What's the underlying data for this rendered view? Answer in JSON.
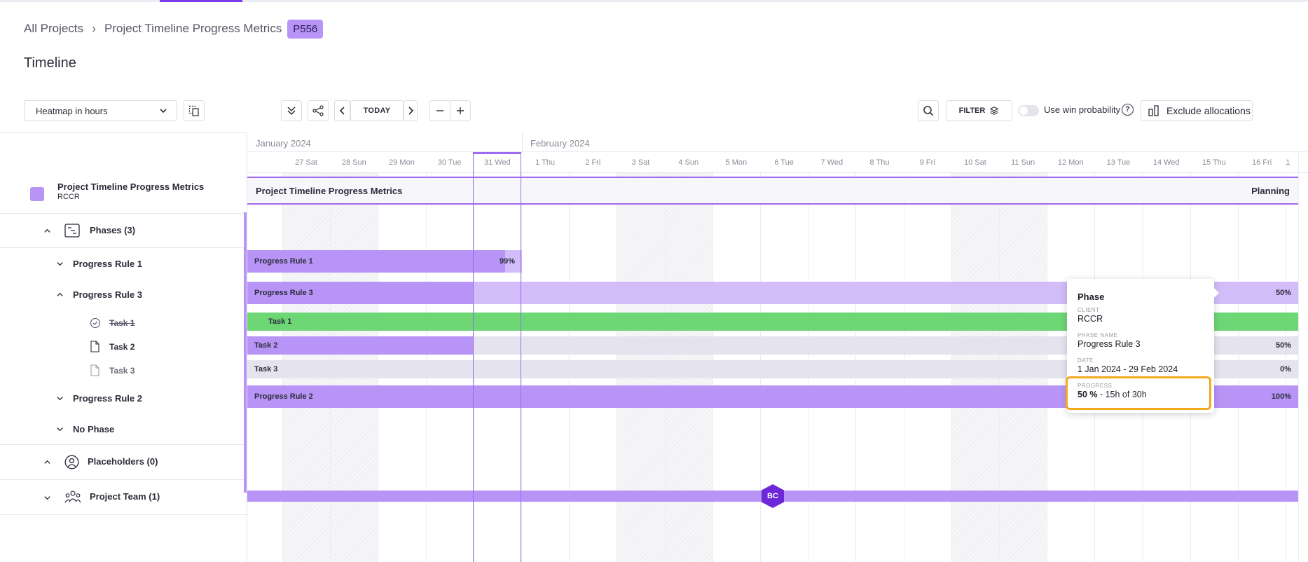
{
  "breadcrumb": {
    "root": "All Projects",
    "current": "Project Timeline Progress Metrics",
    "badge": "P556"
  },
  "page_title": "Timeline",
  "toolbar": {
    "view_select": "Heatmap in hours",
    "today_label": "TODAY",
    "filter_label": "FILTER",
    "win_probability_label": "Use win probability",
    "win_probability_on": false,
    "help_label": "?",
    "exclude_label": "Exclude allocations"
  },
  "left_panel": {
    "project": {
      "name": "Project Timeline Progress Metrics",
      "client": "RCCR",
      "color": "#b794f6"
    },
    "phases_label": "Phases (3)",
    "phases": [
      {
        "label": "Progress Rule 1",
        "expanded": false
      },
      {
        "label": "Progress Rule 3",
        "expanded": true,
        "tasks": [
          {
            "label": "Task 1",
            "done": true
          },
          {
            "label": "Task 2",
            "done": false
          },
          {
            "label": "Task 3",
            "done": false
          }
        ]
      },
      {
        "label": "Progress Rule 2",
        "expanded": false
      },
      {
        "label": "No Phase",
        "expanded": false
      }
    ],
    "placeholders_label": "Placeholders (0)",
    "team_label": "Project Team (1)"
  },
  "timeline": {
    "months": [
      "January 2024",
      "February 2024"
    ],
    "days": [
      "27 Sat",
      "28 Sun",
      "29 Mon",
      "30 Tue",
      "31 Wed",
      "1 Thu",
      "2 Fri",
      "3 Sat",
      "4 Sun",
      "5 Mon",
      "6 Tue",
      "7 Wed",
      "8 Thu",
      "9 Fri",
      "10 Sat",
      "11 Sun",
      "12 Mon",
      "13 Tue",
      "14 Wed",
      "15 Thu",
      "16 Fri",
      "1"
    ],
    "project_header": {
      "title": "Project Timeline Progress Metrics",
      "status": "Planning"
    },
    "bars": {
      "rule1": {
        "label": "Progress Rule 1",
        "pct": "99%",
        "progress": 0.99
      },
      "rule3": {
        "label": "Progress Rule 3",
        "pct": "50%",
        "progress": 0.5
      },
      "task1": {
        "label": "Task 1"
      },
      "task2": {
        "label": "Task 2",
        "pct": "50%",
        "progress": 0.5
      },
      "task3": {
        "label": "Task 3",
        "pct": "0%",
        "progress": 0
      },
      "rule2": {
        "label": "Progress Rule 2",
        "pct": "100%",
        "progress": 1.0
      }
    },
    "team_avatar": "BC"
  },
  "tooltip": {
    "title": "Phase",
    "client_label": "CLIENT",
    "client": "RCCR",
    "phase_name_label": "PHASE NAME",
    "phase_name": "Progress Rule 3",
    "date_label": "DATE",
    "date": "1 Jan 2024 - 29 Feb 2024",
    "progress_label": "PROGRESS",
    "progress_pct": "50 %",
    "progress_detail": " - 15h of 30h"
  },
  "colors": {
    "accent": "#7c3aed",
    "phase_bar": "#b794f6",
    "phase_bar_light": "#d2bcf9",
    "task_done": "#6dd675",
    "task_bg": "#e4e3ee",
    "highlight": "#f2a91e"
  }
}
